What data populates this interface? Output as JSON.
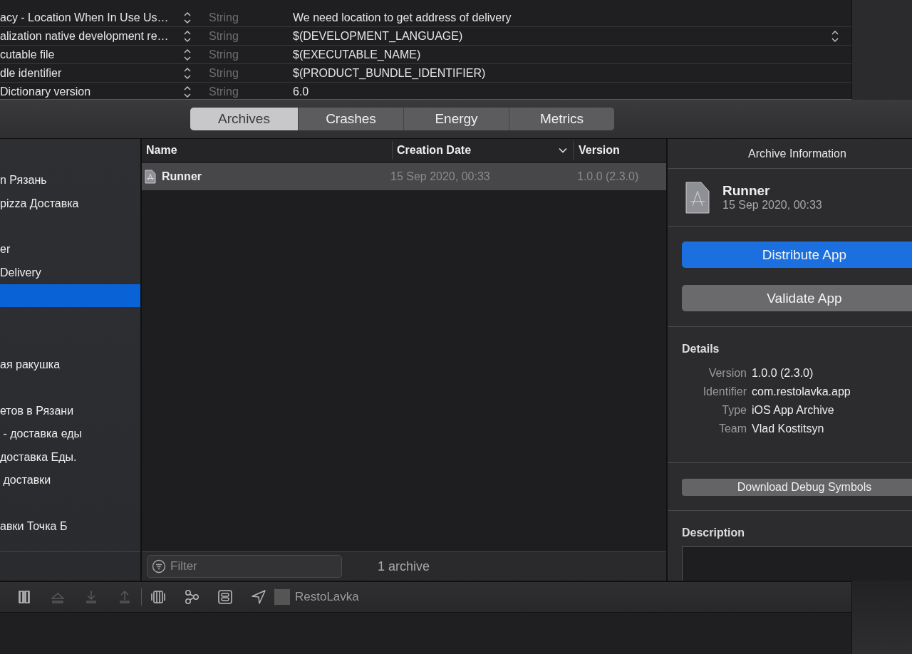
{
  "plist": {
    "rows": [
      {
        "key": "acy - Location When In Use Us…",
        "type": "String",
        "value": "We need location to get address of delivery",
        "kind": "text"
      },
      {
        "key": "alization native development re…",
        "type": "String",
        "value": "$(DEVELOPMENT_LANGUAGE)",
        "kind": "popup"
      },
      {
        "key": "cutable file",
        "type": "String",
        "value": "$(EXECUTABLE_NAME)",
        "kind": "text"
      },
      {
        "key": "dle identifier",
        "type": "String",
        "value": "$(PRODUCT_BUNDLE_IDENTIFIER)",
        "kind": "text"
      },
      {
        "key": "Dictionary version",
        "type": "String",
        "value": "6.0",
        "kind": "text"
      }
    ]
  },
  "organizer": {
    "tabs": [
      {
        "label": "Archives",
        "selected": true
      },
      {
        "label": "Crashes",
        "selected": false
      },
      {
        "label": "Energy",
        "selected": false
      },
      {
        "label": "Metrics",
        "selected": false
      }
    ],
    "sidebar": {
      "items": [
        {
          "label": "n Рязань",
          "selected": false
        },
        {
          "label": "pizza Доставка",
          "selected": false
        },
        {
          "selected": false
        },
        {
          "label": "er",
          "selected": false
        },
        {
          "label": "Delivery",
          "selected": false
        },
        {
          "selected": true
        },
        {
          "selected": false
        },
        {
          "selected": false
        },
        {
          "label": "ая ракушка",
          "selected": false
        },
        {
          "selected": false
        },
        {
          "label": "етов в Рязани",
          "selected": false
        },
        {
          "label": " - доставка еды",
          "selected": false
        },
        {
          "label": "доставка Еды.",
          "selected": false
        },
        {
          "label": " доставки",
          "selected": false
        },
        {
          "selected": false
        },
        {
          "label": "авки Точка Б",
          "selected": false
        }
      ]
    },
    "table": {
      "columns": [
        "Name",
        "Creation Date",
        "Version"
      ],
      "rows": [
        {
          "name": "Runner",
          "date": "15 Sep 2020, 00:33",
          "version": "1.0.0 (2.3.0)",
          "selected": true
        }
      ]
    },
    "filter": {
      "placeholder": "Filter"
    },
    "count": "1 archive",
    "info": {
      "title": "Archive Information",
      "name": "Runner",
      "date": "15 Sep 2020, 00:33",
      "buttons": [
        {
          "label": "Distribute App",
          "kind": "primary"
        },
        {
          "label": "Validate App",
          "kind": "secondary"
        }
      ],
      "details_title": "Details",
      "details": [
        {
          "label": "Version",
          "value": "1.0.0 (2.3.0)"
        },
        {
          "label": "Identifier",
          "value": "com.restolavka.app"
        },
        {
          "label": "Type",
          "value": "iOS App Archive"
        },
        {
          "label": "Team",
          "value": "Vlad Kostitsyn"
        }
      ],
      "debug_button": "Download Debug Symbols",
      "description_title": "Description"
    }
  },
  "toolbar": {
    "buttons": [
      {
        "disabled": false
      },
      {
        "disabled": true
      },
      {
        "disabled": true
      },
      {
        "disabled": true
      },
      {
        "disabled": false
      },
      {
        "disabled": false
      },
      {
        "disabled": false
      },
      {
        "disabled": false
      }
    ],
    "scheme": "RestoLavka"
  }
}
